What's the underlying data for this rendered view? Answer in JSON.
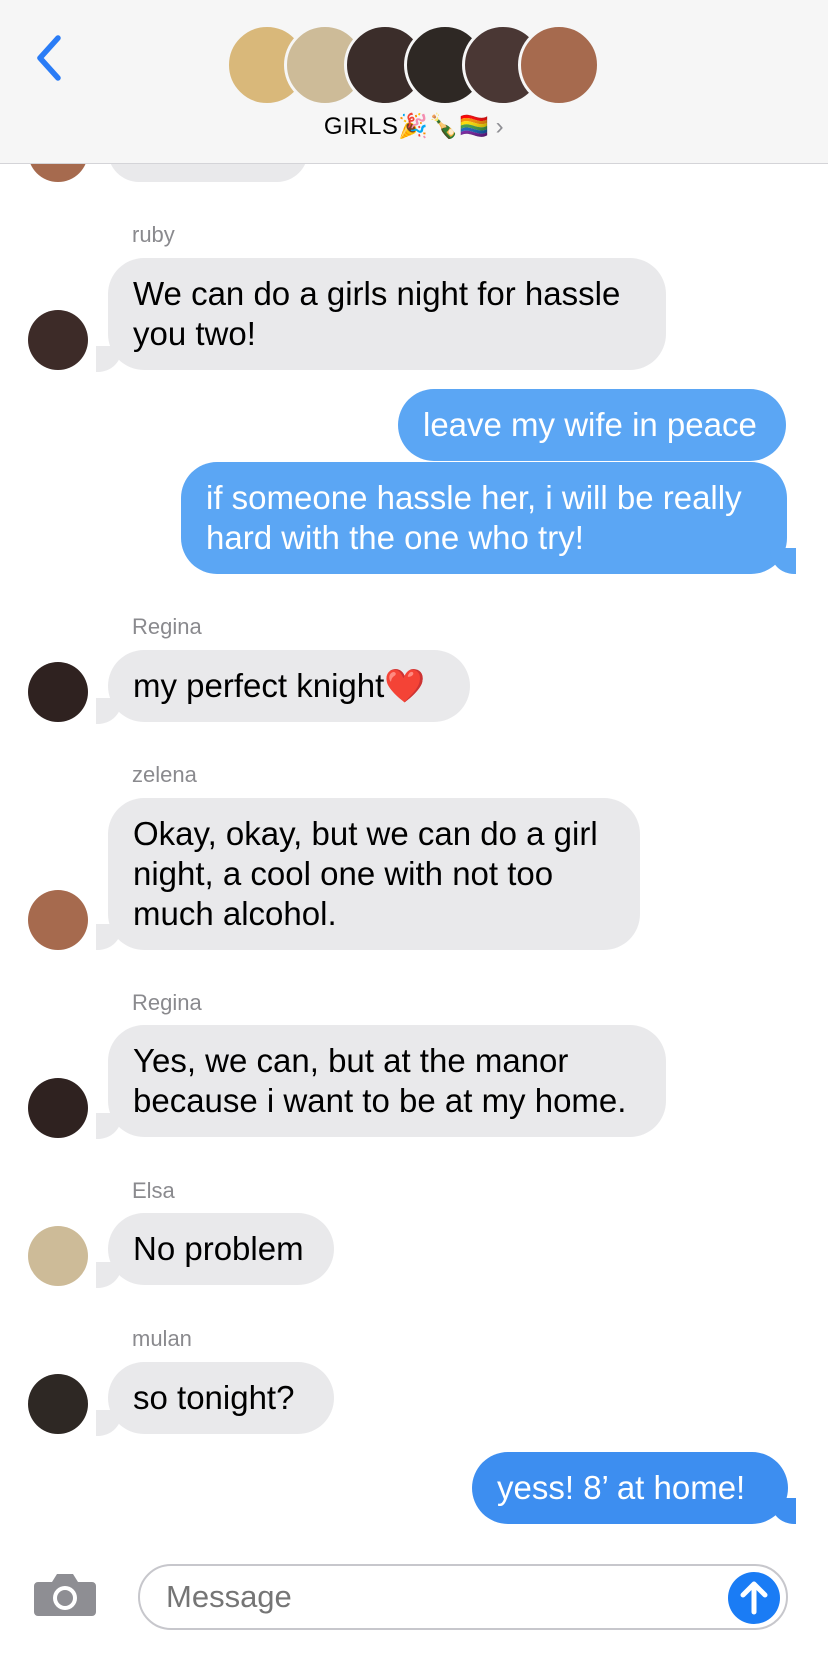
{
  "header": {
    "group_name": "GIRLS🎉🍾🏳️‍🌈",
    "avatars": [
      {
        "name": "avatar-1",
        "color": "#d9b87a"
      },
      {
        "name": "avatar-2",
        "color": "#cdbb98"
      },
      {
        "name": "avatar-3",
        "color": "#3b2d2a"
      },
      {
        "name": "avatar-4",
        "color": "#2e2824"
      },
      {
        "name": "avatar-5",
        "color": "#4a3734"
      },
      {
        "name": "avatar-6",
        "color": "#a66a4e"
      }
    ]
  },
  "messages": [
    {
      "sender": "ruby",
      "text": "We can do a girls night for hassle you two!",
      "direction": "in"
    },
    {
      "sender": "",
      "text": "leave my wife in peace",
      "direction": "out"
    },
    {
      "sender": "",
      "text": "if someone hassle her, i will be really hard with the one who try!",
      "direction": "out"
    },
    {
      "sender": "Regina",
      "text": "my perfect knight❤️",
      "direction": "in"
    },
    {
      "sender": "zelena",
      "text": "Okay, okay, but we can do a girl night, a cool one with not too much alcohol.",
      "direction": "in"
    },
    {
      "sender": "Regina",
      "text": "Yes, we can, but at the manor because i want to be at my home.",
      "direction": "in"
    },
    {
      "sender": "Elsa",
      "text": "No problem",
      "direction": "in"
    },
    {
      "sender": "mulan",
      "text": "so tonight?",
      "direction": "in"
    },
    {
      "sender": "",
      "text": "yess! 8’ at home!",
      "direction": "out"
    }
  ],
  "input": {
    "placeholder": "Message"
  },
  "colors": {
    "incoming_bubble": "#e9e9eb",
    "outgoing_bubble": "#5ba6f4",
    "accent": "#1a7cf5"
  }
}
